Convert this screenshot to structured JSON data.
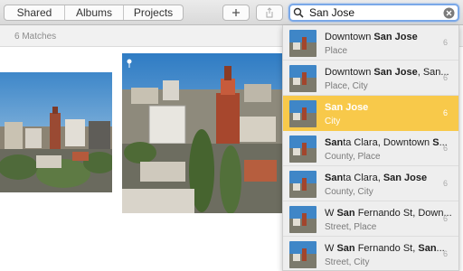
{
  "toolbar": {
    "tabs": [
      "Shared",
      "Albums",
      "Projects"
    ],
    "add_icon": "plus-icon",
    "share_icon": "share-icon"
  },
  "search": {
    "value": "San Jose",
    "icon": "magnifier-icon",
    "clear_icon": "clear-circle-icon"
  },
  "matches_label": "6 Matches",
  "results": [
    {
      "bold": "",
      "pre": "Downtown ",
      "hl": "San Jose",
      "post": "",
      "sub": "Place",
      "count": "6"
    },
    {
      "pre": "Downtown ",
      "hl": "San Jose",
      "post": ", San...",
      "sub": "Place, City",
      "count": "6"
    },
    {
      "pre": "",
      "hl": "San Jose",
      "post": "",
      "sub": "City",
      "count": "6"
    },
    {
      "pre": "",
      "hl": "San",
      "post": "ta Clara, Downtown ",
      "hl2": "S",
      "post2": "...",
      "sub": "County, Place",
      "count": "6"
    },
    {
      "pre": "",
      "hl": "San",
      "post": "ta Clara, ",
      "hl2": "San Jose",
      "post2": "",
      "sub": "County, City",
      "count": "6"
    },
    {
      "pre": "W ",
      "hl": "San",
      "post": " Fernando St, Down...",
      "sub": "Street, Place",
      "count": "6"
    },
    {
      "pre": "W ",
      "hl": "San",
      "post": " Fernando St, ",
      "hl2": "San",
      "post2": "...",
      "sub": "Street, City",
      "count": "6"
    }
  ],
  "selected_index": 2,
  "colors": {
    "selection": "#f8c94a",
    "search_focus": "#7aa8e8"
  }
}
